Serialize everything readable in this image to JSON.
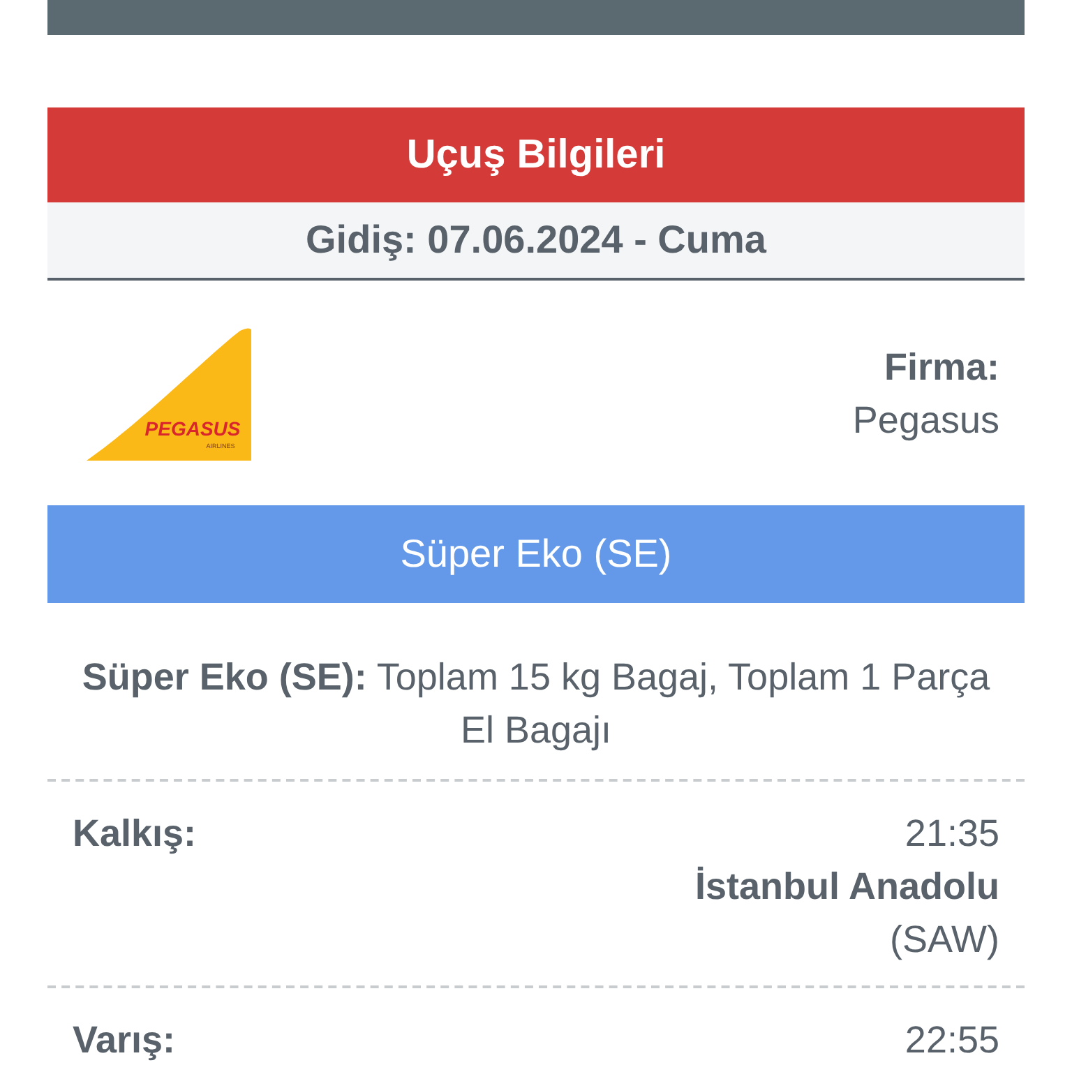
{
  "header": {
    "title": "Uçuş Bilgileri"
  },
  "date_line": "Gidiş: 07.06.2024 - Cuma",
  "airline": {
    "logo": {
      "name": "PEGASUS",
      "sub": "AIRLINES"
    },
    "label": "Firma:",
    "value": "Pegasus"
  },
  "fare_class": "Süper Eko (SE)",
  "fare_description": {
    "label": "Süper Eko (SE):",
    "text": "Toplam 15 kg Bagaj, Toplam 1 Parça El Bagajı"
  },
  "legs": [
    {
      "label": "Kalkış:",
      "time": "21:35",
      "airport": "İstanbul Anadolu",
      "code": "(SAW)"
    },
    {
      "label": "Varış:",
      "time": "22:55"
    }
  ]
}
